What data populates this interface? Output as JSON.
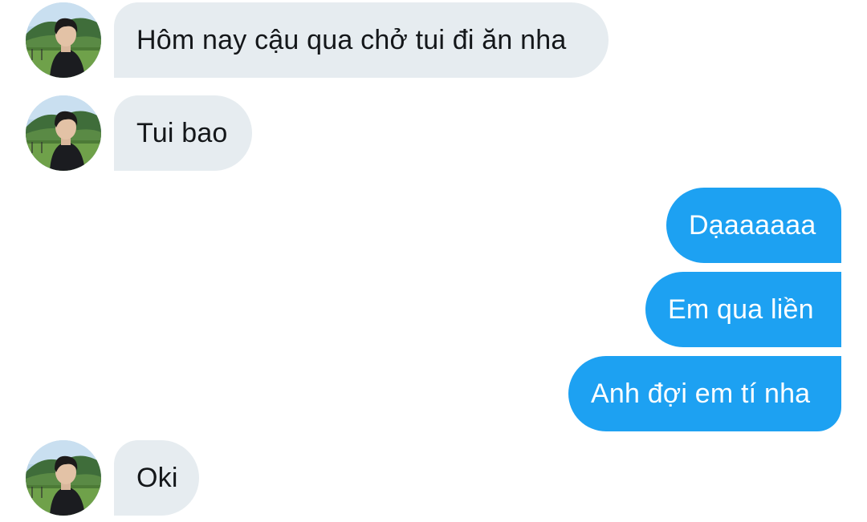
{
  "conversation": {
    "messages": [
      {
        "direction": "incoming",
        "sender_avatar": "avatar-icon",
        "text": "Hôm nay cậu qua chở tui đi ăn nha"
      },
      {
        "direction": "incoming",
        "sender_avatar": "avatar-icon",
        "text": "Tui bao"
      },
      {
        "direction": "outgoing",
        "text": "Dạaaaaaa"
      },
      {
        "direction": "outgoing",
        "text": "Em qua liền"
      },
      {
        "direction": "outgoing",
        "text": "Anh đợi em tí nha"
      },
      {
        "direction": "incoming",
        "sender_avatar": "avatar-icon",
        "text": "Oki"
      }
    ]
  },
  "colors": {
    "incoming_bubble": "#e6ecf0",
    "incoming_text": "#14171a",
    "outgoing_bubble": "#1da1f2",
    "outgoing_text": "#ffffff",
    "background": "#ffffff"
  }
}
